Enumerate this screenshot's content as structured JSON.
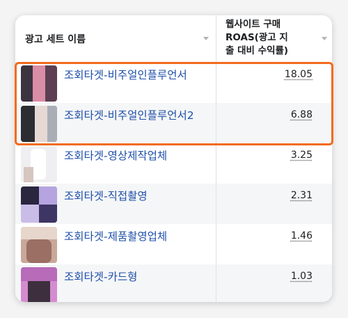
{
  "table": {
    "col_name_header": "광고 세트 이름",
    "col_roas_header": "웹사이트 구매\nROAS(광고 지\n출 대비 수익률)",
    "rows": [
      {
        "name": "조회타겟-비주얼인플루언서",
        "roas": "18.05"
      },
      {
        "name": "조회타겟-비주얼인플루언서2",
        "roas": "6.88"
      },
      {
        "name": "조회타겟-영상제작업체",
        "roas": "3.25"
      },
      {
        "name": "조회타겟-직접촬영",
        "roas": "2.31"
      },
      {
        "name": "조회타겟-제품촬영업체",
        "roas": "1.46"
      },
      {
        "name": "조회타겟-카드형",
        "roas": "1.03"
      }
    ]
  },
  "highlight": {
    "color": "#f26b1d"
  },
  "colors": {
    "link": "#1d4fa8",
    "alt_row": "#f5f6f7"
  }
}
